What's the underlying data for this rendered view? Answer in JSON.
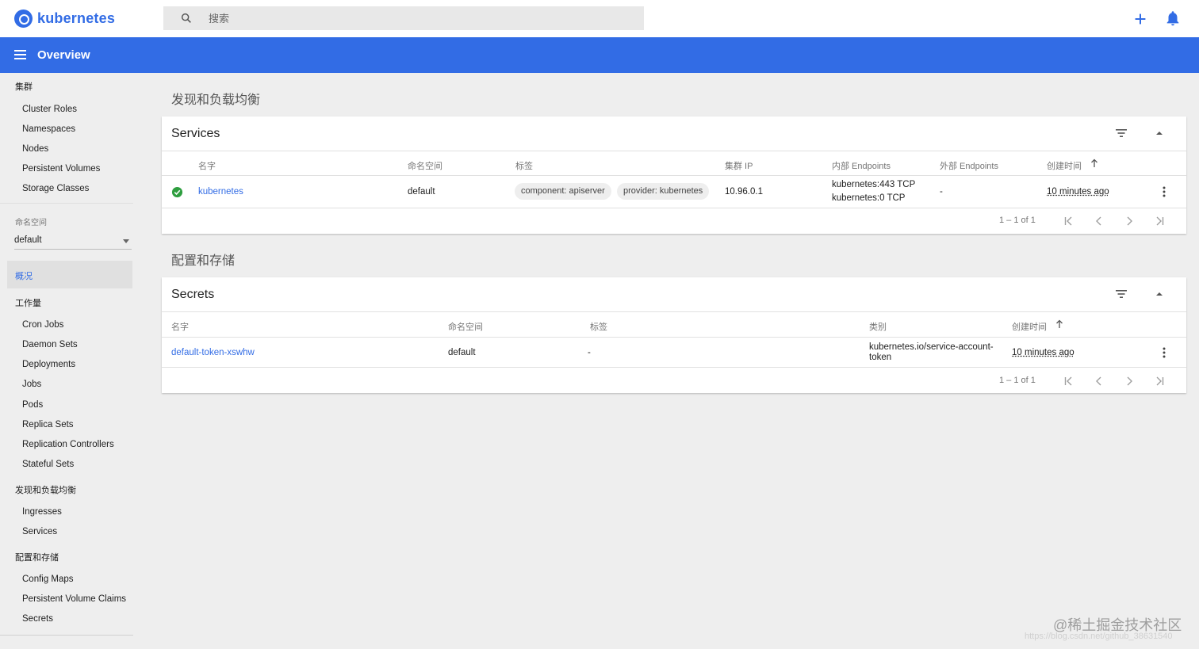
{
  "header": {
    "logo_text": "kubernetes",
    "search_placeholder": "搜索",
    "add_icon": "plus-icon",
    "notifications_icon": "bell-icon"
  },
  "appbar": {
    "title": "Overview",
    "menu_icon": "menu-icon"
  },
  "sidebar": {
    "cluster_label": "集群",
    "cluster_items": [
      "Cluster Roles",
      "Namespaces",
      "Nodes",
      "Persistent Volumes",
      "Storage Classes"
    ],
    "namespace_label": "命名空间",
    "namespace_value": "default",
    "overview_label": "概况",
    "workloads_label": "工作量",
    "workload_items": [
      "Cron Jobs",
      "Daemon Sets",
      "Deployments",
      "Jobs",
      "Pods",
      "Replica Sets",
      "Replication Controllers",
      "Stateful Sets"
    ],
    "discovery_label": "发现和负载均衡",
    "discovery_items": [
      "Ingresses",
      "Services"
    ],
    "config_label": "配置和存储",
    "config_items": [
      "Config Maps",
      "Persistent Volume Claims",
      "Secrets"
    ]
  },
  "main": {
    "discovery_title": "发现和负载均衡",
    "services": {
      "title": "Services",
      "columns": [
        "名字",
        "命名空间",
        "标签",
        "集群 IP",
        "内部 Endpoints",
        "外部 Endpoints",
        "创建时间"
      ],
      "row": {
        "status": "ok",
        "name": "kubernetes",
        "namespace": "default",
        "labels": [
          "component: apiserver",
          "provider: kubernetes"
        ],
        "cluster_ip": "10.96.0.1",
        "internal_endpoints": [
          "kubernetes:443 TCP",
          "kubernetes:0 TCP"
        ],
        "external_endpoints": "-",
        "created": "10 minutes ago"
      },
      "pager": "1 – 1 of 1"
    },
    "config_title": "配置和存储",
    "secrets": {
      "title": "Secrets",
      "columns": [
        "名字",
        "命名空间",
        "标签",
        "类别",
        "创建时间"
      ],
      "row": {
        "name": "default-token-xswhw",
        "namespace": "default",
        "labels": "-",
        "type_line1": "kubernetes.io/service-account-",
        "type_line2": "token",
        "created": "10 minutes ago"
      },
      "pager": "1 – 1 of 1"
    }
  },
  "watermark": {
    "line1": "@稀土掘金技术社区",
    "line2": "https://blog.csdn.net/github_38631540"
  },
  "colors": {
    "brand": "#326ce5",
    "status_ok": "#2e9e3f"
  }
}
